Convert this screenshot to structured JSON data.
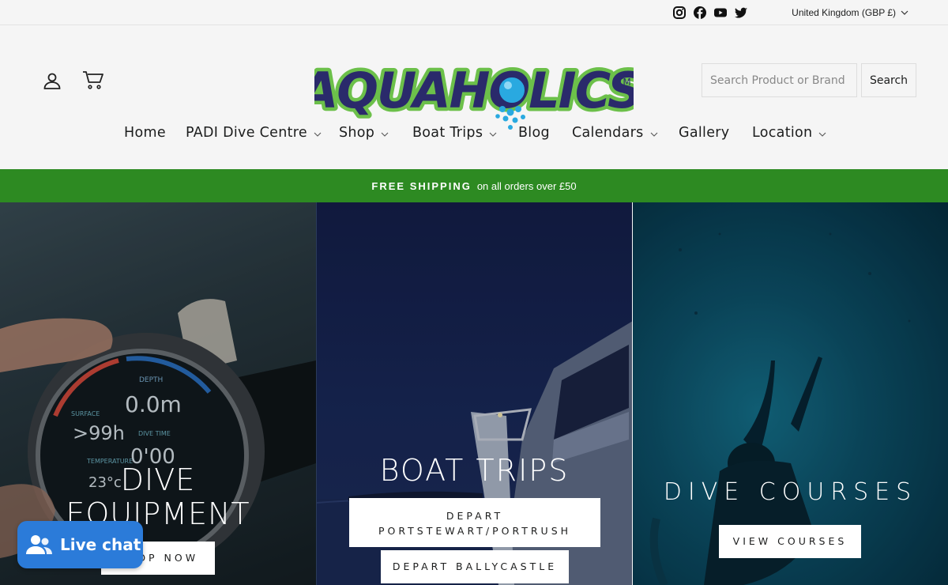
{
  "topbar": {
    "social_icons": [
      "instagram-icon",
      "facebook-icon",
      "youtube-icon",
      "twitter-icon"
    ],
    "currency": "United Kingdom (GBP £)"
  },
  "header": {
    "logo_text": "AQUAHOLICS",
    "logo_mark": "TM",
    "search_placeholder": "Search Product or Brand",
    "search_button": "Search"
  },
  "nav": {
    "items": [
      {
        "label": "Home",
        "dropdown": false
      },
      {
        "label": "PADI Dive Centre",
        "dropdown": true
      },
      {
        "label": "Shop",
        "dropdown": true
      },
      {
        "label": "Boat Trips",
        "dropdown": true
      },
      {
        "label": "Blog",
        "dropdown": false
      },
      {
        "label": "Calendars",
        "dropdown": true
      },
      {
        "label": "Gallery",
        "dropdown": false
      },
      {
        "label": "Location",
        "dropdown": true
      }
    ]
  },
  "promo": {
    "bold": "FREE SHIPPING",
    "text": "on all orders over £50"
  },
  "hero": {
    "panels": [
      {
        "title_line1": "DIVE",
        "title_line2": "EQUIPMENT",
        "button": "SHOP NOW"
      },
      {
        "title": "BOAT TRIPS",
        "button1_line1": "DEPART",
        "button1_line2": "PORTSTEWART/PORTRUSH",
        "button2": "DEPART BALLYCASTLE"
      },
      {
        "title": "DIVE COURSES",
        "button": "VIEW COURSES"
      }
    ],
    "computer_readouts": [
      "DEPTH",
      "0.0m",
      "SURFACE",
      ">99h",
      "DIVE TIME",
      "0'00",
      "TEMPERATURE",
      "23°c"
    ]
  },
  "chat": {
    "label": "Live chat"
  },
  "colors": {
    "promo_bg": "#2d8a22",
    "chat_bg": "#2b7bd9",
    "logo_navy": "#2a2a6b",
    "logo_green": "#6cc04a",
    "logo_blue": "#29a9e0"
  }
}
